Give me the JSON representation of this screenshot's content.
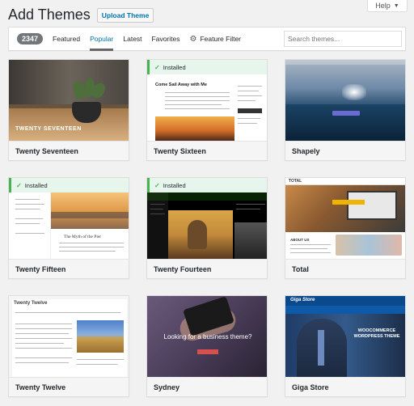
{
  "help": {
    "label": "Help"
  },
  "header": {
    "title": "Add Themes",
    "upload_label": "Upload Theme"
  },
  "filters": {
    "count": "2347",
    "links": [
      "Featured",
      "Popular",
      "Latest",
      "Favorites"
    ],
    "active": "Popular",
    "feature_filter_label": "Feature Filter",
    "search_placeholder": "Search themes..."
  },
  "installed_label": "Installed",
  "themes": [
    {
      "name": "Twenty Seventeen",
      "installed": false,
      "screenshot_text": "TWENTY SEVENTEEN"
    },
    {
      "name": "Twenty Sixteen",
      "installed": true,
      "screenshot_text": "Come Sail Away with Me"
    },
    {
      "name": "Shapely",
      "installed": false
    },
    {
      "name": "Twenty Fifteen",
      "installed": true,
      "screenshot_text": "The Myth of the Pier"
    },
    {
      "name": "Twenty Fourteen",
      "installed": true
    },
    {
      "name": "Total",
      "installed": false,
      "screenshot_text": "TOTAL",
      "screenshot_subtext": "ABOUT US"
    },
    {
      "name": "Twenty Twelve",
      "installed": false,
      "screenshot_text": "Twenty Twelve"
    },
    {
      "name": "Sydney",
      "installed": false,
      "screenshot_text": "Looking for a business theme?"
    },
    {
      "name": "Giga Store",
      "installed": false,
      "screenshot_text": "Giga Store",
      "screenshot_subtext": "WOOCOMMERCE WORDPRESS THEME"
    }
  ],
  "colors": {
    "accent": "#0073aa",
    "installed_green": "#46b450",
    "badge": "#72777c"
  }
}
